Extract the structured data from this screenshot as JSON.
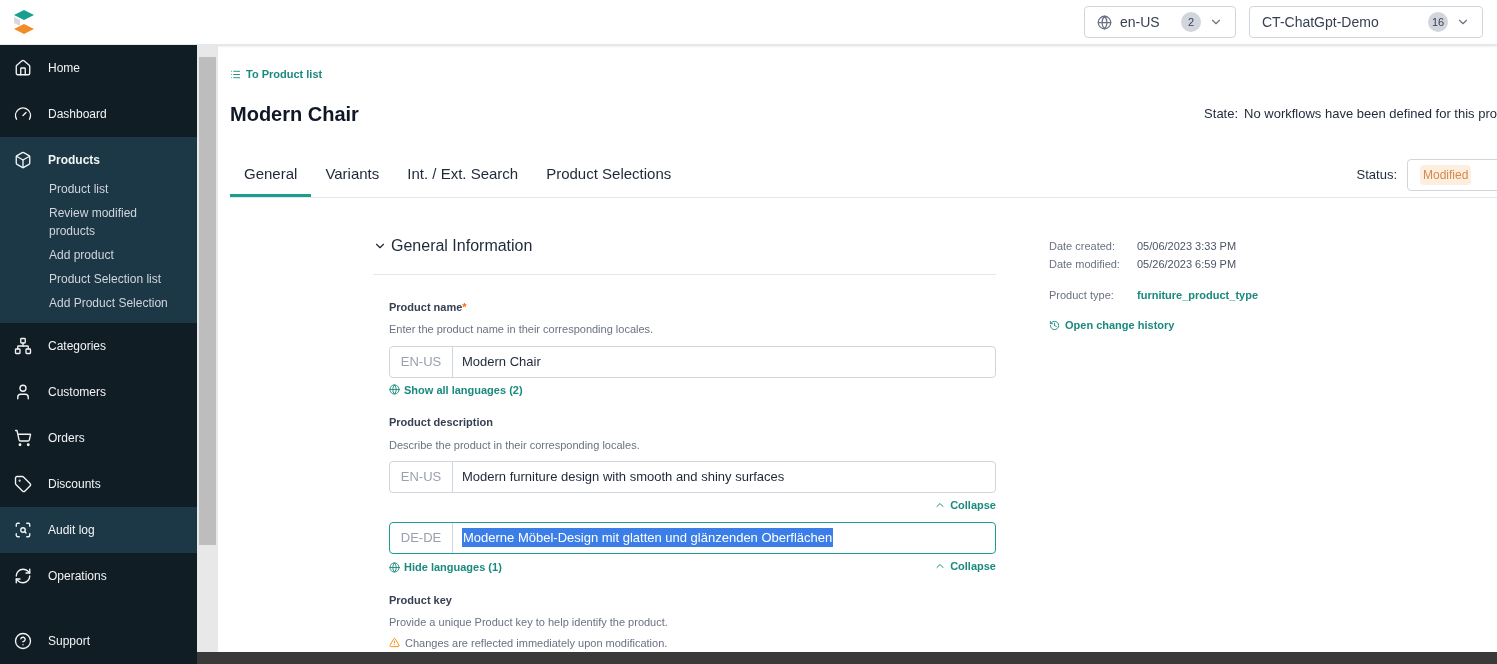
{
  "header": {
    "locale": {
      "label": "en-US",
      "count": "2"
    },
    "project": {
      "label": "CT-ChatGpt-Demo",
      "count": "16"
    }
  },
  "sidebar": {
    "items": [
      {
        "label": "Home",
        "highlighted": false,
        "expanded": false
      },
      {
        "label": "Dashboard",
        "highlighted": false,
        "expanded": false
      },
      {
        "label": "Products",
        "highlighted": true,
        "expanded": true,
        "children": [
          "Product list",
          "Review modified products",
          "Add product",
          "Product Selection list",
          "Add Product Selection"
        ]
      },
      {
        "label": "Categories",
        "highlighted": false,
        "expanded": false
      },
      {
        "label": "Customers",
        "highlighted": false,
        "expanded": false
      },
      {
        "label": "Orders",
        "highlighted": false,
        "expanded": false
      },
      {
        "label": "Discounts",
        "highlighted": false,
        "expanded": false
      },
      {
        "label": "Audit log",
        "highlighted": true,
        "expanded": false
      },
      {
        "label": "Operations",
        "highlighted": false,
        "expanded": false
      }
    ],
    "support": "Support"
  },
  "breadcrumb": "To Product list",
  "title": "Modern Chair",
  "state": {
    "label": "State:",
    "value": "No workflows have been defined for this pro"
  },
  "status": {
    "label": "Status:",
    "value": "Modified"
  },
  "tabs": [
    {
      "label": "General",
      "selected": true
    },
    {
      "label": "Variants",
      "selected": false
    },
    {
      "label": "Int. / Ext. Search",
      "selected": false
    },
    {
      "label": "Product Selections",
      "selected": false
    }
  ],
  "section": {
    "title": "General Information",
    "expanded": true
  },
  "fields": [
    {
      "label": "Product name",
      "required_mark": "*",
      "hint": "Enter the product name in their corresponding locales.",
      "rows": [
        {
          "locale": "EN-US",
          "value": "Modern Chair",
          "focused": false,
          "collapse": ""
        }
      ],
      "toggle": "Show all languages (2)"
    },
    {
      "label": "Product description",
      "hint": "Describe the product in their corresponding locales.",
      "rows": [
        {
          "locale": "EN-US",
          "value": "Modern furniture design with smooth and shiny surfaces",
          "focused": false,
          "collapse": "Collapse"
        },
        {
          "locale": "DE-DE",
          "value": "Moderne Möbel-Design mit glatten und glänzenden Oberflächen",
          "focused": true,
          "collapse": "Collapse"
        }
      ],
      "toggle": "Hide languages (1)"
    },
    {
      "label": "Product key",
      "hint": "Provide a unique Product key to help identify the product.",
      "warning": "Changes are reflected immediately upon modification."
    }
  ],
  "info": {
    "created_label": "Date created:",
    "created": "05/06/2023 3:33 PM",
    "modified_label": "Date modified:",
    "modified": "05/26/2023 6:59 PM",
    "type_label": "Product type:",
    "type": "furniture_product_type",
    "history": "Open change history"
  }
}
